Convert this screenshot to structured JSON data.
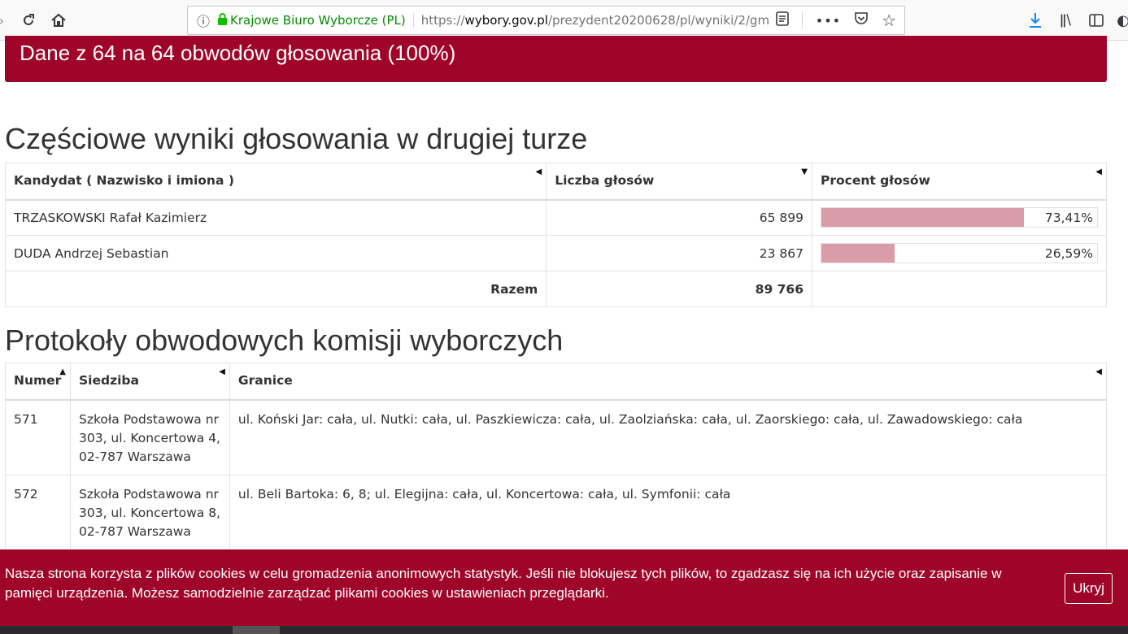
{
  "browser": {
    "url_org": "Krajowe Biuro Wyborcze (PL)",
    "url_prefix": "https://",
    "url_domain": "wybory.gov.pl",
    "url_path": "/prezydent20200628/pl/wyniki/2/gm"
  },
  "data_bar": {
    "text": "Dane z 64 na 64 obwodów głosowania (100%)"
  },
  "results": {
    "heading": "Częściowe wyniki głosowania w drugiej turze",
    "columns": [
      "Kandydat ( Nazwisko i imiona )",
      "Liczba głosów",
      "Procent głosów"
    ],
    "rows": [
      {
        "name": "TRZASKOWSKI Rafał Kazimierz",
        "votes": "65 899",
        "percent_label": "73,41%",
        "percent": 73.41
      },
      {
        "name": "DUDA Andrzej Sebastian",
        "votes": "23 867",
        "percent_label": "26,59%",
        "percent": 26.59
      }
    ],
    "total_label": "Razem",
    "total_votes": "89 766"
  },
  "protocols": {
    "heading": "Protokoły obwodowych komisji wyborczych",
    "columns": [
      "Numer",
      "Siedziba",
      "Granice"
    ],
    "rows": [
      {
        "number": "571",
        "seat": "Szkoła Podstawowa nr 303, ul. Koncertowa 4, 02-787 Warszawa",
        "bounds": "ul. Koński Jar: cała, ul. Nutki: cała, ul. Paszkiewicza: cała, ul. Zaolziańska: cała, ul. Zaorskiego: cała, ul. Zawadowskiego: cała"
      },
      {
        "number": "572",
        "seat": "Szkoła Podstawowa nr 303, ul. Koncertowa 8, 02-787 Warszawa",
        "bounds": "ul. Beli Bartoka: 6, 8; ul. Elegijna: cała, ul. Koncertowa: cała, ul. Symfonii: cała"
      }
    ]
  },
  "cookie": {
    "text": "Nasza strona korzysta z plików cookies w celu gromadzenia anonimowych statystyk. Jeśli nie blokujesz tych plików, to zgadzasz się na ich użycie oraz zapisanie w pamięci urządzenia. Możesz samodzielnie zarządzać plikami cookies w ustawieniach przeglądarki.",
    "button": "Ukryj"
  },
  "icons": {
    "reload": "reload-icon",
    "home": "home-icon",
    "info": "info-icon",
    "lock": "lock-icon",
    "reader": "reader-view-icon",
    "more": "more-icon",
    "pocket": "pocket-icon",
    "bookmark": "bookmark-star-icon",
    "download": "download-icon",
    "library": "library-icon",
    "sidebar": "sidebar-icon"
  },
  "colors": {
    "brand": "#9e0528",
    "bar": "#d99ca8"
  }
}
